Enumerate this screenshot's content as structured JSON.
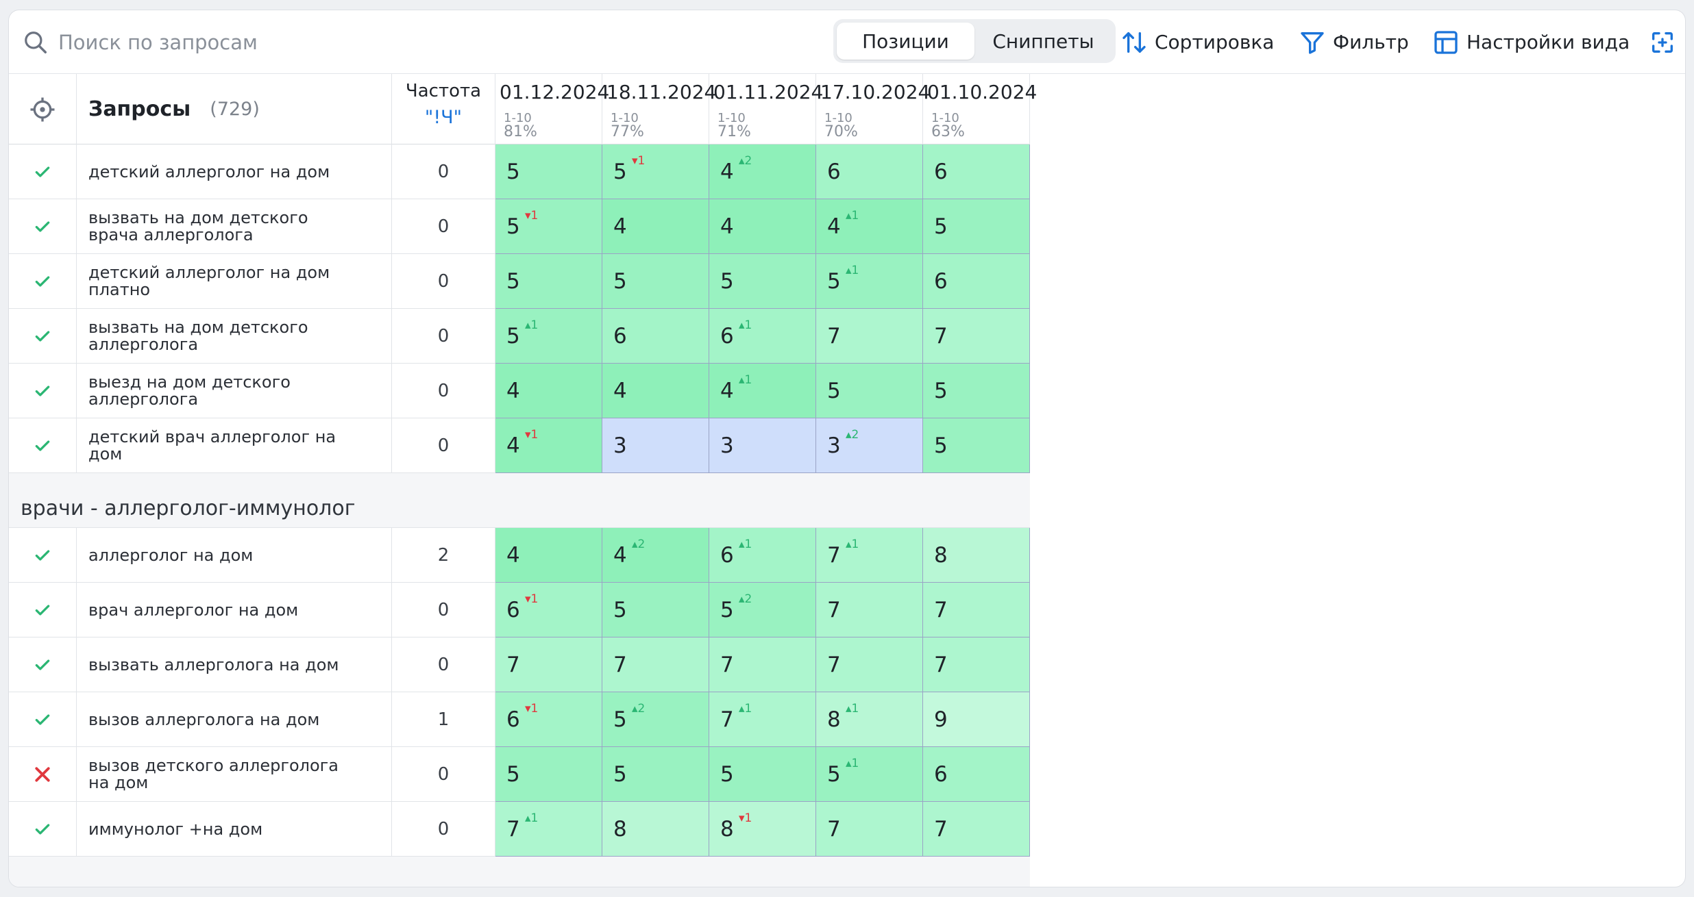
{
  "search": {
    "placeholder": "Поиск по запросам"
  },
  "tabs": [
    {
      "label": "Позиции",
      "active": true
    },
    {
      "label": "Сниппеты",
      "active": false
    }
  ],
  "toolbar": {
    "sort_label": "Сортировка",
    "filter_label": "Фильтр",
    "view_label": "Настройки вида"
  },
  "colors": {
    "accent": "#1a73d9",
    "up": "#2bb673",
    "down": "#e0383e",
    "check": "#2bb673",
    "cross": "#e0383e"
  },
  "header": {
    "queries_label": "Запросы",
    "queries_count": "(729)",
    "freq_label": "Частота",
    "freq_sub": "\"!Ч\"",
    "dates": [
      {
        "date": "01.12.2024",
        "range": "1-10",
        "pct": "81%"
      },
      {
        "date": "18.11.2024",
        "range": "1-10",
        "pct": "77%"
      },
      {
        "date": "01.11.2024",
        "range": "1-10",
        "pct": "71%"
      },
      {
        "date": "17.10.2024",
        "range": "1-10",
        "pct": "70%"
      },
      {
        "date": "01.10.2024",
        "range": "1-10",
        "pct": "63%"
      }
    ]
  },
  "sections": [
    {
      "title": "",
      "rows": [
        {
          "status": "ok",
          "query": "детский аллерголог на дом",
          "freq": "0",
          "positions": [
            {
              "v": "5",
              "d": ""
            },
            {
              "v": "5",
              "d": "▾1"
            },
            {
              "v": "4",
              "d": "▴2"
            },
            {
              "v": "6",
              "d": ""
            },
            {
              "v": "6",
              "d": ""
            }
          ]
        },
        {
          "status": "ok",
          "query": "вызвать на дом детского врача аллерголога",
          "freq": "0",
          "positions": [
            {
              "v": "5",
              "d": "▾1"
            },
            {
              "v": "4",
              "d": ""
            },
            {
              "v": "4",
              "d": ""
            },
            {
              "v": "4",
              "d": "▴1"
            },
            {
              "v": "5",
              "d": ""
            }
          ]
        },
        {
          "status": "ok",
          "query": "детский аллерголог на дом платно",
          "freq": "0",
          "positions": [
            {
              "v": "5",
              "d": ""
            },
            {
              "v": "5",
              "d": ""
            },
            {
              "v": "5",
              "d": ""
            },
            {
              "v": "5",
              "d": "▴1"
            },
            {
              "v": "6",
              "d": ""
            }
          ]
        },
        {
          "status": "ok",
          "query": "вызвать на дом детского аллерголога",
          "freq": "0",
          "positions": [
            {
              "v": "5",
              "d": "▴1"
            },
            {
              "v": "6",
              "d": ""
            },
            {
              "v": "6",
              "d": "▴1"
            },
            {
              "v": "7",
              "d": ""
            },
            {
              "v": "7",
              "d": ""
            }
          ]
        },
        {
          "status": "ok",
          "query": "выезд на дом детского аллерголога",
          "freq": "0",
          "positions": [
            {
              "v": "4",
              "d": ""
            },
            {
              "v": "4",
              "d": ""
            },
            {
              "v": "4",
              "d": "▴1"
            },
            {
              "v": "5",
              "d": ""
            },
            {
              "v": "5",
              "d": ""
            }
          ]
        },
        {
          "status": "ok",
          "query": "детский врач аллерголог на дом",
          "freq": "0",
          "positions": [
            {
              "v": "4",
              "d": "▾1"
            },
            {
              "v": "3",
              "d": ""
            },
            {
              "v": "3",
              "d": ""
            },
            {
              "v": "3",
              "d": "▴2"
            },
            {
              "v": "5",
              "d": ""
            }
          ]
        }
      ]
    },
    {
      "title": "врачи - аллерголог-иммунолог",
      "rows": [
        {
          "status": "ok",
          "query": "аллерголог на дом",
          "freq": "2",
          "positions": [
            {
              "v": "4",
              "d": ""
            },
            {
              "v": "4",
              "d": "▴2"
            },
            {
              "v": "6",
              "d": "▴1"
            },
            {
              "v": "7",
              "d": "▴1"
            },
            {
              "v": "8",
              "d": ""
            }
          ]
        },
        {
          "status": "ok",
          "query": "врач аллерголог на дом",
          "freq": "0",
          "positions": [
            {
              "v": "6",
              "d": "▾1"
            },
            {
              "v": "5",
              "d": ""
            },
            {
              "v": "5",
              "d": "▴2"
            },
            {
              "v": "7",
              "d": ""
            },
            {
              "v": "7",
              "d": ""
            }
          ]
        },
        {
          "status": "ok",
          "query": "вызвать аллерголога на дом",
          "freq": "0",
          "positions": [
            {
              "v": "7",
              "d": ""
            },
            {
              "v": "7",
              "d": ""
            },
            {
              "v": "7",
              "d": ""
            },
            {
              "v": "7",
              "d": ""
            },
            {
              "v": "7",
              "d": ""
            }
          ]
        },
        {
          "status": "ok",
          "query": "вызов аллерголога на дом",
          "freq": "1",
          "positions": [
            {
              "v": "6",
              "d": "▾1"
            },
            {
              "v": "5",
              "d": "▴2"
            },
            {
              "v": "7",
              "d": "▴1"
            },
            {
              "v": "8",
              "d": "▴1"
            },
            {
              "v": "9",
              "d": ""
            }
          ]
        },
        {
          "status": "fail",
          "query": "вызов детского аллерголога на дом",
          "freq": "0",
          "positions": [
            {
              "v": "5",
              "d": ""
            },
            {
              "v": "5",
              "d": ""
            },
            {
              "v": "5",
              "d": ""
            },
            {
              "v": "5",
              "d": "▴1"
            },
            {
              "v": "6",
              "d": ""
            }
          ]
        },
        {
          "status": "ok",
          "query": "иммунолог +на дом",
          "freq": "0",
          "positions": [
            {
              "v": "7",
              "d": "▴1"
            },
            {
              "v": "8",
              "d": ""
            },
            {
              "v": "8",
              "d": "▾1"
            },
            {
              "v": "7",
              "d": ""
            },
            {
              "v": "7",
              "d": ""
            }
          ]
        }
      ]
    }
  ]
}
